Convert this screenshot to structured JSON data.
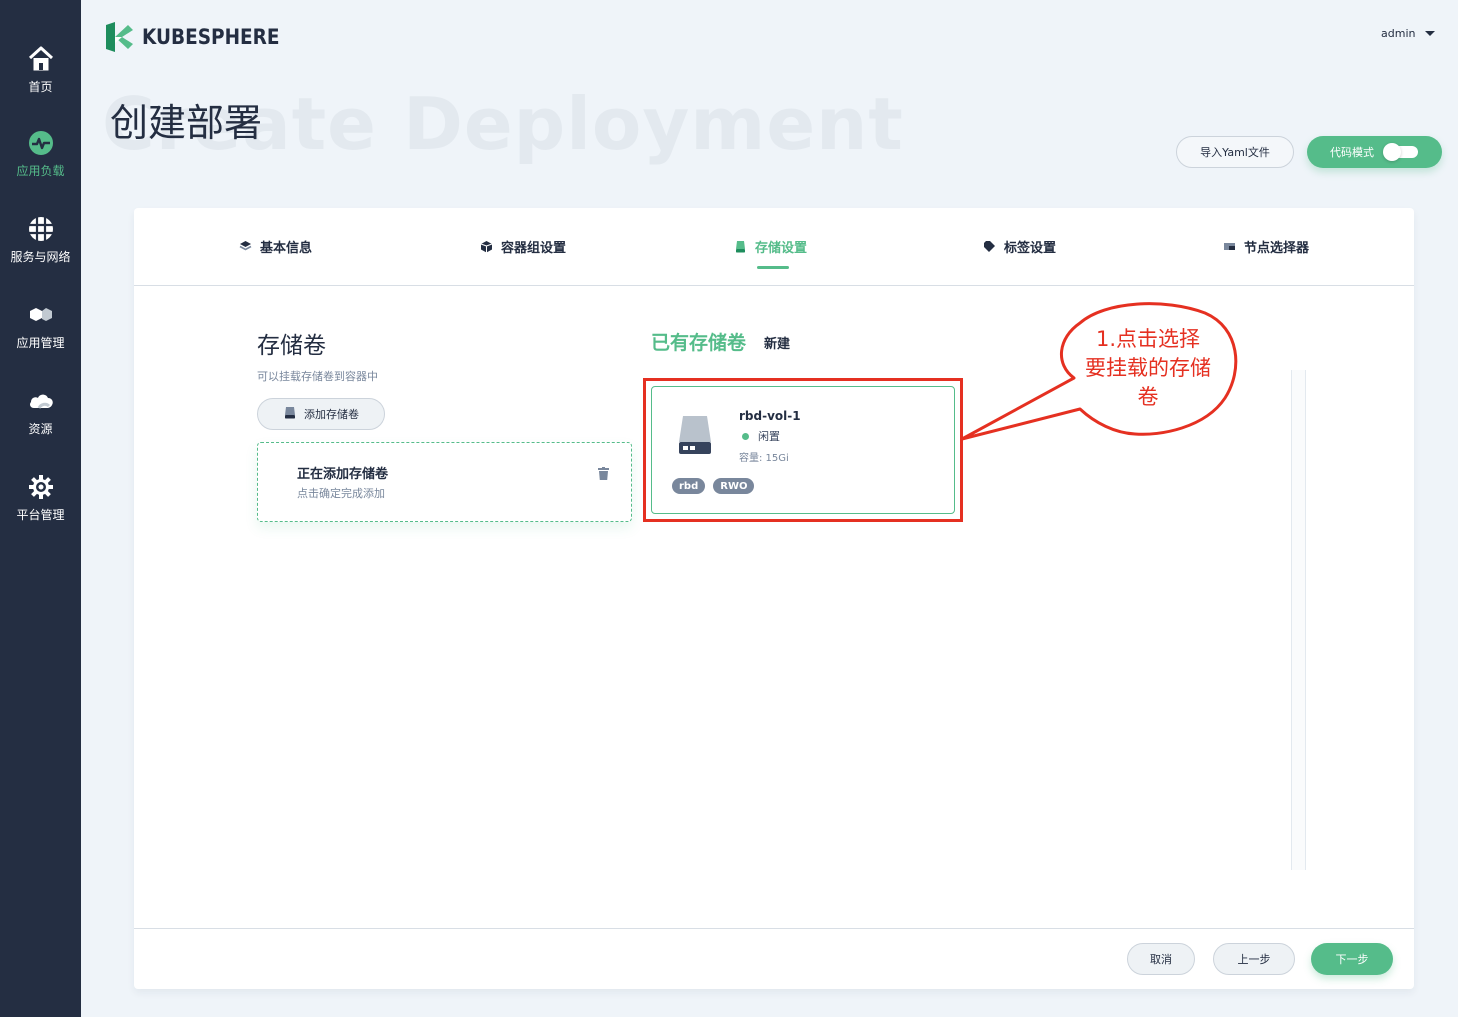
{
  "sidebar": {
    "items": [
      {
        "label": "首页",
        "icon": "home-icon"
      },
      {
        "label": "应用负载",
        "icon": "workload-icon",
        "active": true
      },
      {
        "label": "服务与网络",
        "icon": "network-icon"
      },
      {
        "label": "应用管理",
        "icon": "app-icon"
      },
      {
        "label": "资源",
        "icon": "cloud-icon"
      },
      {
        "label": "平台管理",
        "icon": "gear-icon"
      }
    ]
  },
  "header": {
    "logo_text": "KUBESPHERE",
    "user": "admin"
  },
  "page": {
    "bg_title": "Create Deployment",
    "title": "创建部署",
    "import_yaml_label": "导入Yaml文件",
    "code_mode_label": "代码模式"
  },
  "steps": [
    {
      "label": "基本信息",
      "icon": "layers-icon"
    },
    {
      "label": "容器组设置",
      "icon": "cube-icon"
    },
    {
      "label": "存储设置",
      "icon": "disk-icon",
      "active": true
    },
    {
      "label": "标签设置",
      "icon": "tag-icon"
    },
    {
      "label": "节点选择器",
      "icon": "node-icon"
    }
  ],
  "volumes_panel": {
    "title": "存储卷",
    "description": "可以挂载存储卷到容器中",
    "add_button": "添加存储卷",
    "adding_title": "正在添加存储卷",
    "adding_desc": "点击确定完成添加"
  },
  "existing_panel": {
    "tab_existing": "已有存储卷",
    "tab_new": "新建",
    "volume": {
      "name": "rbd-vol-1",
      "status": "闲置",
      "capacity": "容量: 15Gi",
      "tags": [
        "rbd",
        "RWO"
      ]
    }
  },
  "footer": {
    "cancel": "取消",
    "prev": "上一步",
    "next": "下一步"
  },
  "annotation": {
    "text_line1": "1.点击选择",
    "text_line2": "要挂载的存储",
    "text_line3": "卷",
    "color": "#e53021"
  },
  "colors": {
    "accent": "#55bc8a",
    "sidebar": "#242e42",
    "background": "#eff4f9"
  }
}
